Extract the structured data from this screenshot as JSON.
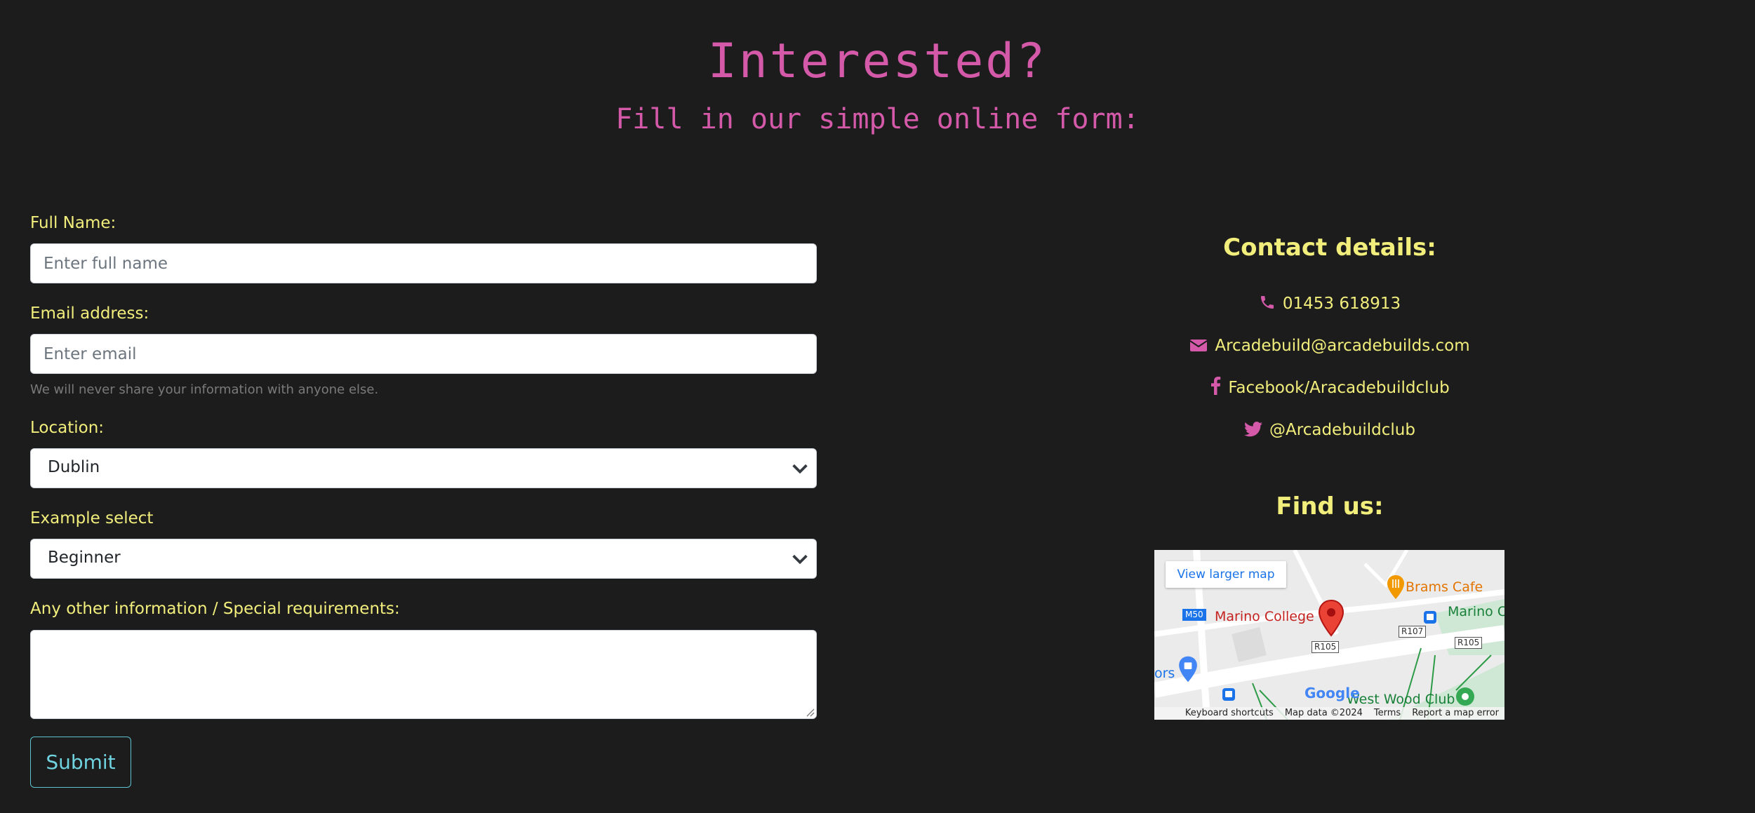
{
  "hero": {
    "title": "Interested?",
    "subtitle": "Fill in our simple online form:"
  },
  "form": {
    "full_name": {
      "label": "Full Name:",
      "placeholder": "Enter full name"
    },
    "email": {
      "label": "Email address:",
      "placeholder": "Enter email",
      "help": "We will never share your information with anyone else."
    },
    "location": {
      "label": "Location:",
      "selected": "Dublin"
    },
    "level": {
      "label": "Example select",
      "selected": "Beginner"
    },
    "other": {
      "label": "Any other information / Special requirements:"
    },
    "submit_label": "Submit"
  },
  "contact": {
    "heading": "Contact details:",
    "items": [
      {
        "icon": "phone-icon",
        "text": "01453 618913"
      },
      {
        "icon": "envelope-icon",
        "text": "Arcadebuild@arcadebuilds.com"
      },
      {
        "icon": "facebook-icon",
        "text": "Facebook/Aracadebuildclub"
      },
      {
        "icon": "twitter-icon",
        "text": "@Arcadebuildclub"
      }
    ],
    "find_heading": "Find us:"
  },
  "map": {
    "view_larger": "View larger map",
    "places": [
      "Marino College",
      "Brams Cafe",
      "Marino Crescent",
      "West Wood Club"
    ],
    "road_tags": [
      "M50",
      "R105",
      "R107",
      "R105"
    ],
    "partial_label": "ors",
    "logo": "Google",
    "footer": [
      "Keyboard shortcuts",
      "Map data ©2024",
      "Terms",
      "Report a map error"
    ]
  },
  "colors": {
    "background": "#1c1c1d",
    "heading_pink": "#d45aa9",
    "text_yellow": "#f2ee7c",
    "button_cyan": "#6fd3e0"
  }
}
